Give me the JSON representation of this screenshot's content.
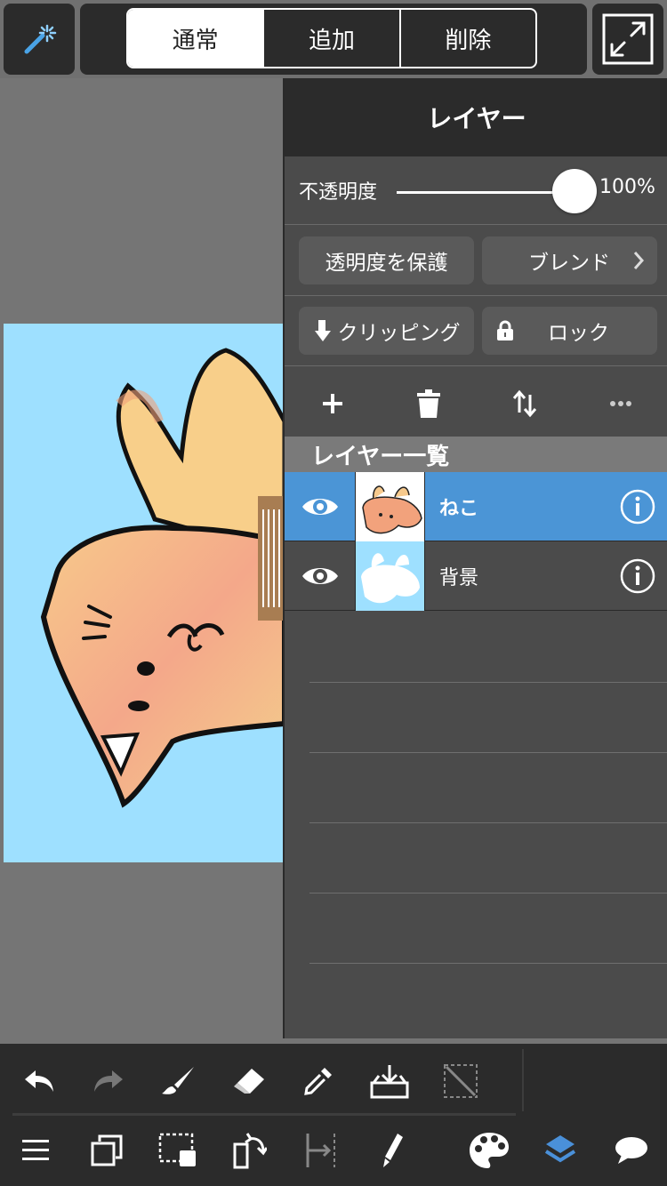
{
  "top_bar": {
    "segments": [
      "通常",
      "追加",
      "削除"
    ],
    "selected_segment": "通常"
  },
  "panel": {
    "title": "レイヤー",
    "opacity_label": "不透明度",
    "opacity_value": "100%",
    "opacity_fraction": 1.0,
    "protect_alpha_label": "透明度を保護",
    "blend_label": "ブレンド",
    "clipping_label": "クリッピング",
    "lock_label": "ロック",
    "list_header": "レイヤー一覧",
    "layers": [
      {
        "name": "ねこ",
        "selected": true
      },
      {
        "name": "背景",
        "selected": false
      }
    ]
  },
  "colors": {
    "accent": "#4a90d9",
    "selected_row": "#4b95d6",
    "panel_bg": "#4b4b4b",
    "toolbar_bg": "#2b2b2b",
    "canvas_bg": "#9ee0ff"
  },
  "icons": {
    "top_left": "magic-wand-icon",
    "top_right": "fullscreen-icon",
    "bottom_row1": [
      "undo-icon",
      "redo-icon",
      "brush-icon",
      "eraser-icon",
      "eyedropper-icon",
      "save-icon",
      "deselect-icon"
    ],
    "bottom_row2": [
      "menu-icon",
      "layers-copy-icon",
      "selection-icon",
      "transform-icon",
      "ruler-icon",
      "pen-icon",
      "palette-icon",
      "layers-icon",
      "speech-bubble-icon"
    ]
  }
}
